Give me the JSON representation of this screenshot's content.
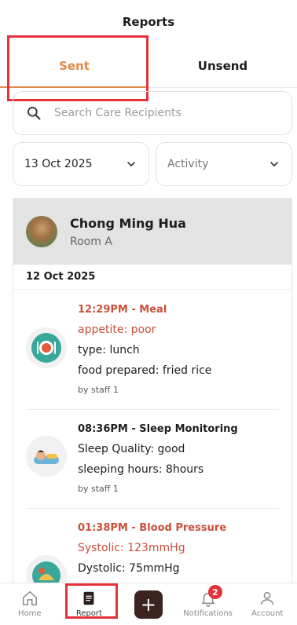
{
  "header": {
    "title": "Reports"
  },
  "tabs": [
    {
      "label": "Sent",
      "active": true
    },
    {
      "label": "Unsend",
      "active": false
    }
  ],
  "search": {
    "placeholder": "Search Care Recipients",
    "value": ""
  },
  "filters": {
    "date": "13 Oct 2025",
    "type": "Activity"
  },
  "recipient": {
    "name": "Chong Ming Hua",
    "room": "Room A"
  },
  "group_date": "12 Oct 2025",
  "entries": [
    {
      "title": "12:29PM - Meal",
      "icon": "meal-icon",
      "lines": [
        "appetite: poor",
        "type: lunch",
        "food prepared: fried rice"
      ],
      "by": "by staff 1"
    },
    {
      "title": "08:36PM - Sleep Monitoring",
      "icon": "sleep-icon",
      "lines": [
        "Sleep Quality: good",
        "sleeping hours: 8hours"
      ],
      "by": "by staff 1"
    },
    {
      "title": "01:38PM - Blood Pressure",
      "icon": "blood-pressure-icon",
      "lines": [
        "Systolic: 123mmHg",
        "Dystolic: 75mmHg"
      ],
      "by": ""
    }
  ],
  "nav": {
    "home": "Home",
    "report": "Report",
    "notifications": "Notifications",
    "notifications_badge": "2",
    "account": "Account"
  },
  "colors": {
    "accent": "#e0894a",
    "alert": "#c9503a",
    "highlight": "#e53238",
    "add_button": "#3a2320"
  }
}
